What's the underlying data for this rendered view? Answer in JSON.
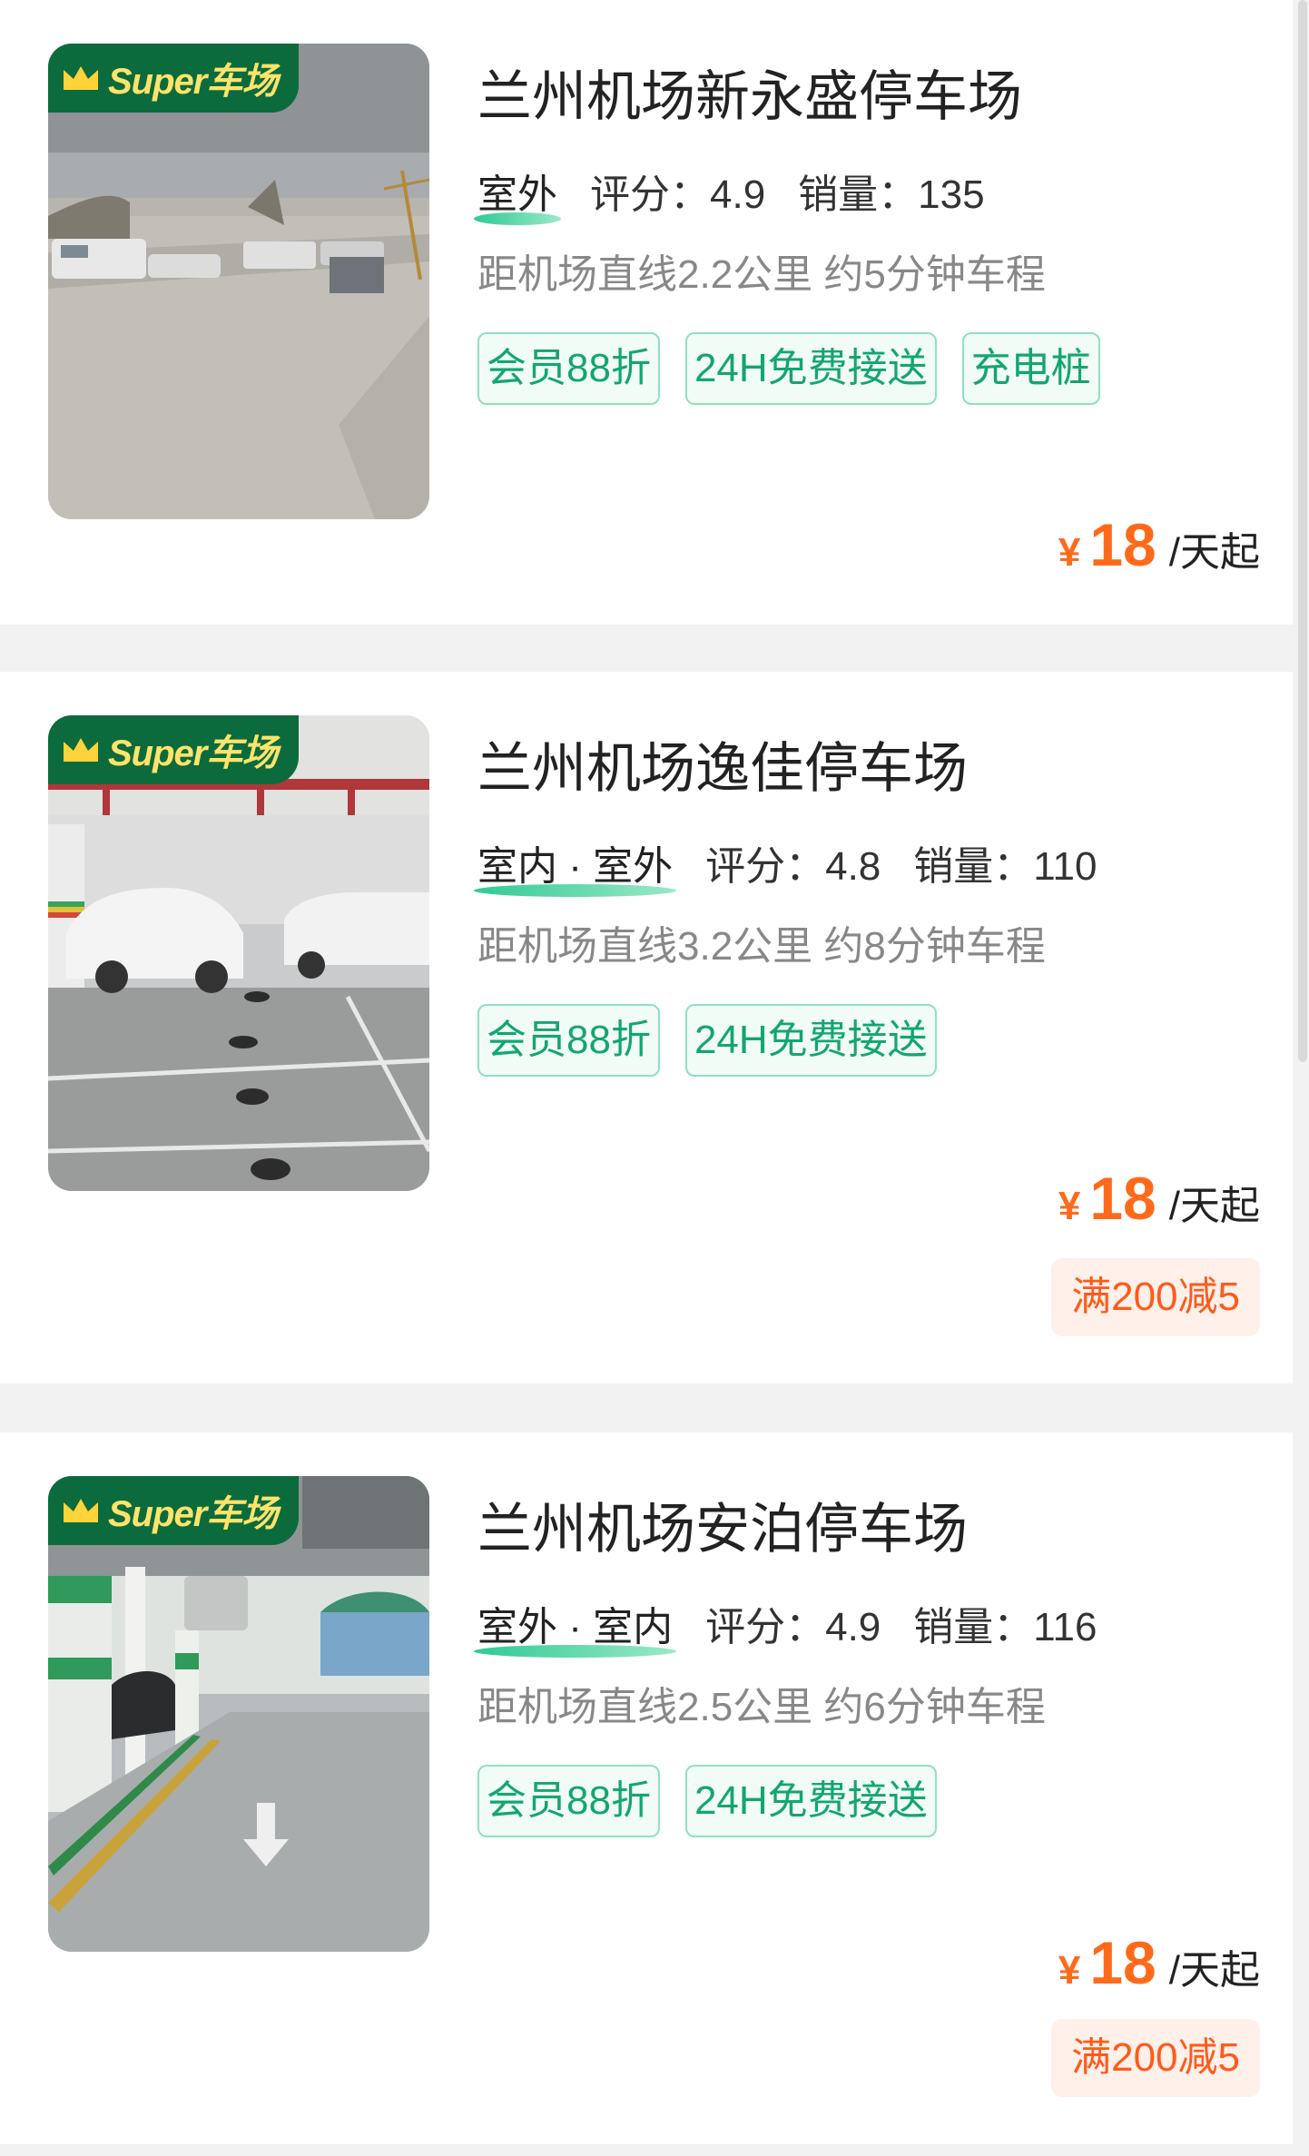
{
  "badge_text": "Super车场",
  "lots": [
    {
      "name": "兰州机场新永盛停车场",
      "location_type": "室外",
      "rating": "评分：4.9",
      "sales": "销量：135",
      "distance": "距机场直线2.2公里 约5分钟车程",
      "tags": [
        "会员88折",
        "24H免费接送",
        "充电桩"
      ],
      "currency": "¥",
      "price": "18",
      "price_unit": "/天起",
      "promo": ""
    },
    {
      "name": "兰州机场逸佳停车场",
      "location_type": "室内 · 室外",
      "rating": "评分：4.8",
      "sales": "销量：110",
      "distance": "距机场直线3.2公里 约8分钟车程",
      "tags": [
        "会员88折",
        "24H免费接送"
      ],
      "currency": "¥",
      "price": "18",
      "price_unit": "/天起",
      "promo": "满200减5"
    },
    {
      "name": "兰州机场安泊停车场",
      "location_type": "室外 · 室内",
      "rating": "评分：4.9",
      "sales": "销量：116",
      "distance": "距机场直线2.5公里 约6分钟车程",
      "tags": [
        "会员88折",
        "24H免费接送"
      ],
      "currency": "¥",
      "price": "18",
      "price_unit": "/天起",
      "promo": "满200减5"
    }
  ],
  "colors": {
    "accent_green": "#13a66e",
    "badge_green": "#0b6b3c",
    "price_orange": "#ff6a1a",
    "promo_bg": "#fff0ea"
  }
}
